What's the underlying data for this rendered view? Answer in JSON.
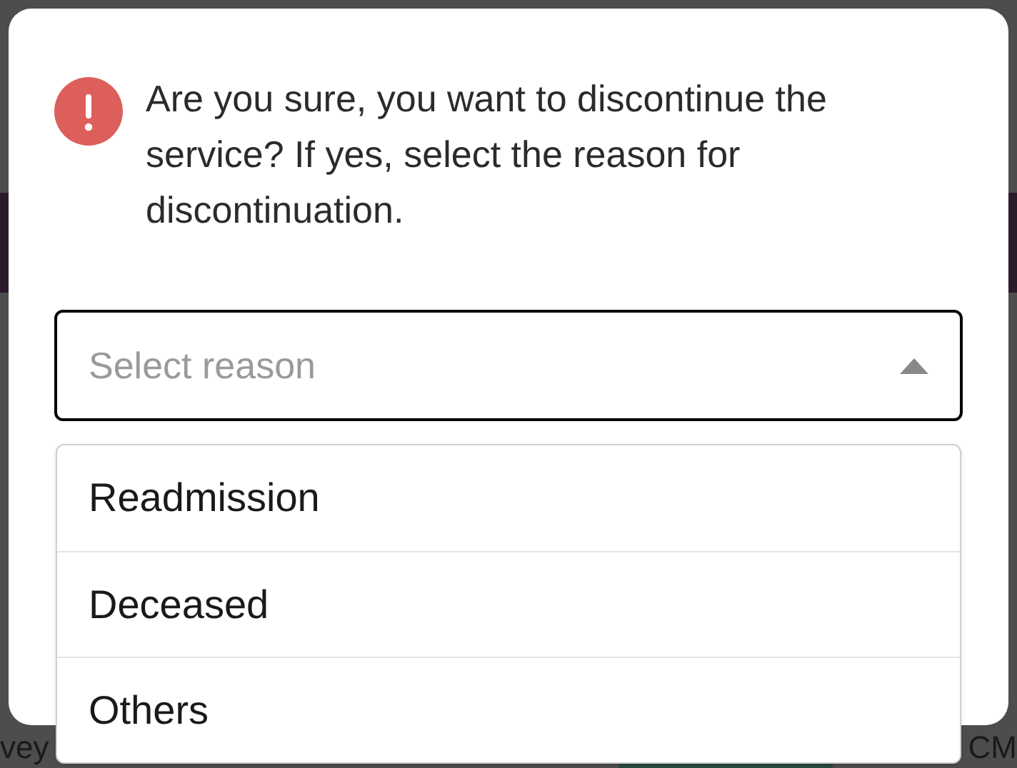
{
  "background": {
    "left_text": "vey",
    "right_text": "CM"
  },
  "dialog": {
    "message": "Are you sure, you want to discontinue the service? If yes, select the reason for discontinuation.",
    "select": {
      "placeholder": "Select reason",
      "expanded": true
    },
    "options": [
      {
        "label": "Readmission",
        "selected": false
      },
      {
        "label": "Deceased",
        "selected": false
      },
      {
        "label": "Others",
        "selected": false
      }
    ]
  }
}
